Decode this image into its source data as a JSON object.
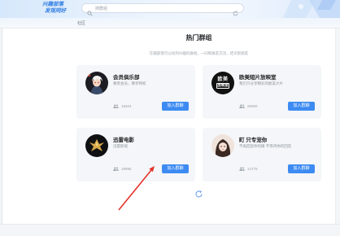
{
  "header": {
    "logo_line1": "兴趣部落",
    "logo_line2": "发现同好",
    "search_text": "搜群组",
    "search_icon": "search-icon",
    "refresh_icon": "refresh-icon"
  },
  "nav": {
    "tab_label": "社区"
  },
  "section": {
    "title": "热门群组",
    "subtitle": "在趣部落可以找到兴趣的群组，一同和群友交流，结识新朋友",
    "refresh_icon": "refresh-icon"
  },
  "groups": [
    {
      "name": "会员俱乐部",
      "description": "尊贵会员，尊享特权",
      "members": "18404",
      "join_label": "加入群聊"
    },
    {
      "name": "欧美短片放映室",
      "description": "我们只分享精彩的欧美大片",
      "members": "26060",
      "join_label": "加入群聊",
      "avatar_text": [
        "欧美",
        "放映室"
      ]
    },
    {
      "name": "迅雷电影",
      "description": "迅雷影视",
      "members": "19995",
      "join_label": "加入群聊"
    },
    {
      "name": "町 只专宠你",
      "description": "不再回首你的眼 不等待你的回答",
      "members": "14775",
      "join_label": "加入群聊"
    }
  ],
  "colors": {
    "accent": "#3d8bf2",
    "card_bg": "#f4f6f9",
    "logo": "#2f7de1",
    "annotation_arrow": "#e5332a"
  }
}
